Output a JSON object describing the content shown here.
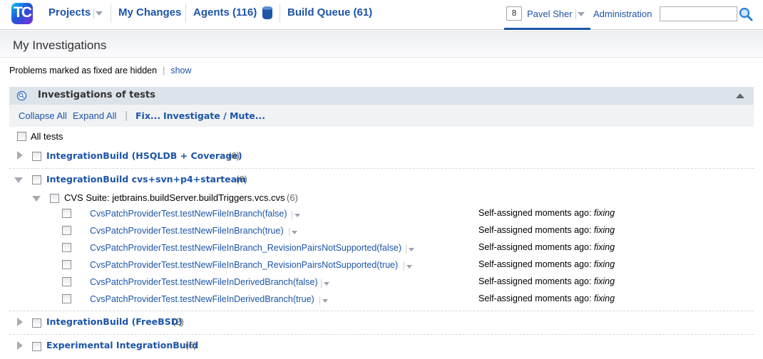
{
  "logo": {
    "text": "TC"
  },
  "nav": {
    "projects": "Projects",
    "my_changes": "My Changes",
    "agents": "Agents (116)",
    "build_queue": "Build Queue (61)"
  },
  "user": {
    "badge": "8",
    "name": "Pavel Sher"
  },
  "admin": "Administration",
  "search": {
    "placeholder": ""
  },
  "page_title": "My Investigations",
  "hidden_note": {
    "text": "Problems marked as fixed are hidden",
    "link": "show"
  },
  "section": {
    "title": "Investigations of tests",
    "toolbar": {
      "collapse_all": "Collapse All",
      "expand_all": "Expand All",
      "fix": "Fix...",
      "investigate": "Investigate / Mute..."
    }
  },
  "all_tests": "All tests",
  "groups": [
    {
      "name": "IntegrationBuild (HSQLDB + Coverage)",
      "count": "(6)"
    },
    {
      "name": "IntegrationBuild cvs+svn+p4+starteam",
      "count": "(6)",
      "suite": {
        "name": "CVS Suite: jetbrains.buildServer.buildTriggers.vcs.cvs",
        "count": "(6)"
      },
      "tests": [
        {
          "name": "CvsPatchProviderTest.testNewFileInBranch(false)",
          "status": "Self-assigned moments ago:",
          "state": "fixing"
        },
        {
          "name": "CvsPatchProviderTest.testNewFileInBranch(true)",
          "status": "Self-assigned moments ago:",
          "state": "fixing"
        },
        {
          "name": "CvsPatchProviderTest.testNewFileInBranch_RevisionPairsNotSupported(false)",
          "status": "Self-assigned moments ago:",
          "state": "fixing"
        },
        {
          "name": "CvsPatchProviderTest.testNewFileInBranch_RevisionPairsNotSupported(true)",
          "status": "Self-assigned moments ago:",
          "state": "fixing"
        },
        {
          "name": "CvsPatchProviderTest.testNewFileInDerivedBranch(false)",
          "status": "Self-assigned moments ago:",
          "state": "fixing"
        },
        {
          "name": "CvsPatchProviderTest.testNewFileInDerivedBranch(true)",
          "status": "Self-assigned moments ago:",
          "state": "fixing"
        }
      ]
    },
    {
      "name": "IntegrationBuild (FreeBSD)",
      "count": "(2)"
    },
    {
      "name": "Experimental IntegrationBuild",
      "count": "(6)"
    }
  ]
}
